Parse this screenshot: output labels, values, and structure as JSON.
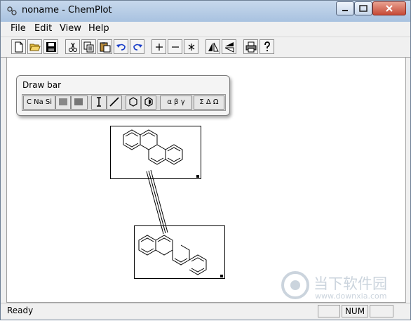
{
  "window": {
    "title": "noname - ChemPlot"
  },
  "menubar": {
    "file": "File",
    "edit": "Edit",
    "view": "View",
    "help": "Help"
  },
  "drawbar": {
    "title": "Draw bar",
    "elements_label": "C Na Si",
    "greek_label": "α β γ",
    "symbols_label": "Σ Δ Ω"
  },
  "status": {
    "ready": "Ready",
    "num": "NUM"
  },
  "watermark": {
    "cn": "当下软件园",
    "url": "www.downxia.com"
  }
}
